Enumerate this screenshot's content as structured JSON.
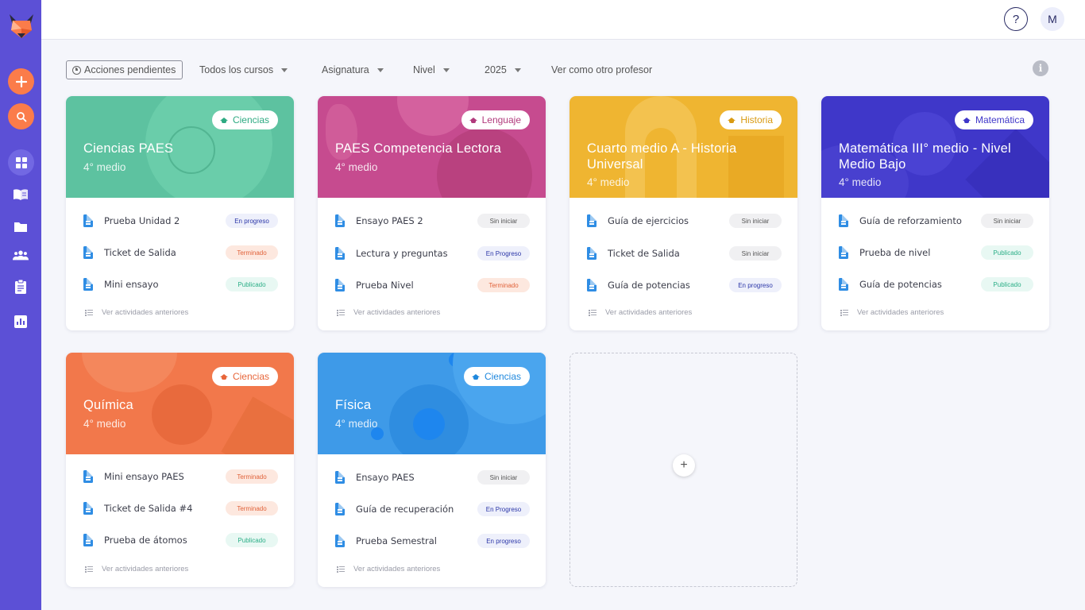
{
  "topbar": {
    "help": "?",
    "avatar": "M"
  },
  "filters": {
    "pending": "Acciones pendientes",
    "courses": "Todos los cursos",
    "subject": "Asignatura",
    "level": "Nivel",
    "year": "2025",
    "other_teacher": "Ver como otro profesor"
  },
  "more_label": "Ver actividades anteriores",
  "colors": {
    "sidebar": "#5c50d6",
    "accent": "#fb7c4a",
    "doc": "#2f8de4"
  },
  "cards": [
    {
      "subject": "Ciencias",
      "title": "Ciencias PAES",
      "level": "4° medio",
      "activities": [
        {
          "name": "Prueba Unidad 2",
          "status": "En progreso"
        },
        {
          "name": "Ticket de Salida",
          "status": "Terminado"
        },
        {
          "name": "Mini ensayo",
          "status": "Publicado"
        }
      ]
    },
    {
      "subject": "Lenguaje",
      "title": "PAES Competencia Lectora",
      "level": "4° medio",
      "activities": [
        {
          "name": "Ensayo PAES 2",
          "status": "Sin iniciar"
        },
        {
          "name": "Lectura y preguntas",
          "status": "En Progreso"
        },
        {
          "name": "Prueba Nivel",
          "status": "Terminado"
        }
      ]
    },
    {
      "subject": "Historia",
      "title": "Cuarto medio A - Historia Universal",
      "level": "4° medio",
      "activities": [
        {
          "name": "Guía de ejercicios",
          "status": "Sin iniciar"
        },
        {
          "name": "Ticket de Salida",
          "status": "Sin iniciar"
        },
        {
          "name": "Guía de potencias",
          "status": "En progreso"
        }
      ]
    },
    {
      "subject": "Matemática",
      "title": "Matemática III° medio - Nivel Medio Bajo",
      "level": "4° medio",
      "activities": [
        {
          "name": "Guía de reforzamiento",
          "status": "Sin iniciar"
        },
        {
          "name": "Prueba de nivel",
          "status": "Publicado"
        },
        {
          "name": "Guía de potencias",
          "status": "Publicado"
        }
      ]
    },
    {
      "subject": "Ciencias",
      "title": "Química",
      "level": "4° medio",
      "activities": [
        {
          "name": "Mini ensayo PAES",
          "status": "Terminado"
        },
        {
          "name": "Ticket de Salida #4",
          "status": "Terminado"
        },
        {
          "name": "Prueba de átomos",
          "status": "Publicado"
        }
      ]
    },
    {
      "subject": "Ciencias",
      "title": "Física",
      "level": "4° medio",
      "activities": [
        {
          "name": "Ensayo PAES",
          "status": "Sin iniciar"
        },
        {
          "name": "Guía de recuperación",
          "status": "En Progreso"
        },
        {
          "name": "Prueba Semestral",
          "status": "En progreso"
        }
      ]
    }
  ],
  "add_course": "+"
}
